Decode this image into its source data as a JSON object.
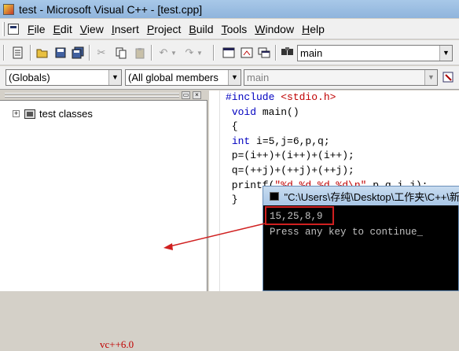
{
  "window": {
    "title": "test - Microsoft Visual C++ - [test.cpp]"
  },
  "menu": [
    {
      "label": "File"
    },
    {
      "label": "Edit"
    },
    {
      "label": "View"
    },
    {
      "label": "Insert"
    },
    {
      "label": "Project"
    },
    {
      "label": "Build"
    },
    {
      "label": "Tools"
    },
    {
      "label": "Window"
    },
    {
      "label": "Help"
    }
  ],
  "toolbar": {
    "find_combo_value": "main"
  },
  "wizardbar": {
    "class_combo": "(Globals)",
    "filter_combo": "(All global members",
    "member_combo": "main"
  },
  "workspace": {
    "tree_root": "test classes"
  },
  "annotation": {
    "text": "vc++6.0"
  },
  "editor": {
    "lines": [
      {
        "text": "#include <stdio.h>",
        "parts": [
          {
            "t": "#include ",
            "c": "kw"
          },
          {
            "t": "<stdio.h>",
            "c": "str"
          }
        ]
      },
      {
        "text": " void main()",
        "parts": [
          {
            "t": " ",
            "c": ""
          },
          {
            "t": "void",
            "c": "kw"
          },
          {
            "t": " main()",
            "c": ""
          }
        ]
      },
      {
        "text": " {",
        "parts": [
          {
            "t": " {",
            "c": ""
          }
        ]
      },
      {
        "text": " int i=5,j=6,p,q;",
        "parts": [
          {
            "t": " ",
            "c": ""
          },
          {
            "t": "int",
            "c": "kw"
          },
          {
            "t": " i=5,j=6,p,q;",
            "c": ""
          }
        ]
      },
      {
        "text": " p=(i++)+(i++)+(i++);",
        "parts": [
          {
            "t": " p=(i++)+(i++)+(i++);",
            "c": ""
          }
        ]
      },
      {
        "text": " q=(++j)+(++j)+(++j);",
        "parts": [
          {
            "t": " q=(++j)+(++j)+(++j);",
            "c": ""
          }
        ]
      },
      {
        "text": " printf(\"%d,%d,%d,%d\\n\",p,q,i,j);",
        "parts": [
          {
            "t": " printf(",
            "c": ""
          },
          {
            "t": "\"%d,%d,%d,%d\\n\"",
            "c": "str"
          },
          {
            "t": ",p,q,i,j);",
            "c": ""
          }
        ]
      },
      {
        "text": " }",
        "parts": [
          {
            "t": " }",
            "c": ""
          }
        ]
      }
    ]
  },
  "console": {
    "title": "\"C:\\Users\\存纯\\Desktop\\工作夹\\C++\\新",
    "output_line1": "15,25,8,9",
    "output_line2": "Press any key to continue"
  },
  "colors": {
    "keyword": "#0000c0",
    "string": "#c00000",
    "annotation": "#c00000"
  }
}
